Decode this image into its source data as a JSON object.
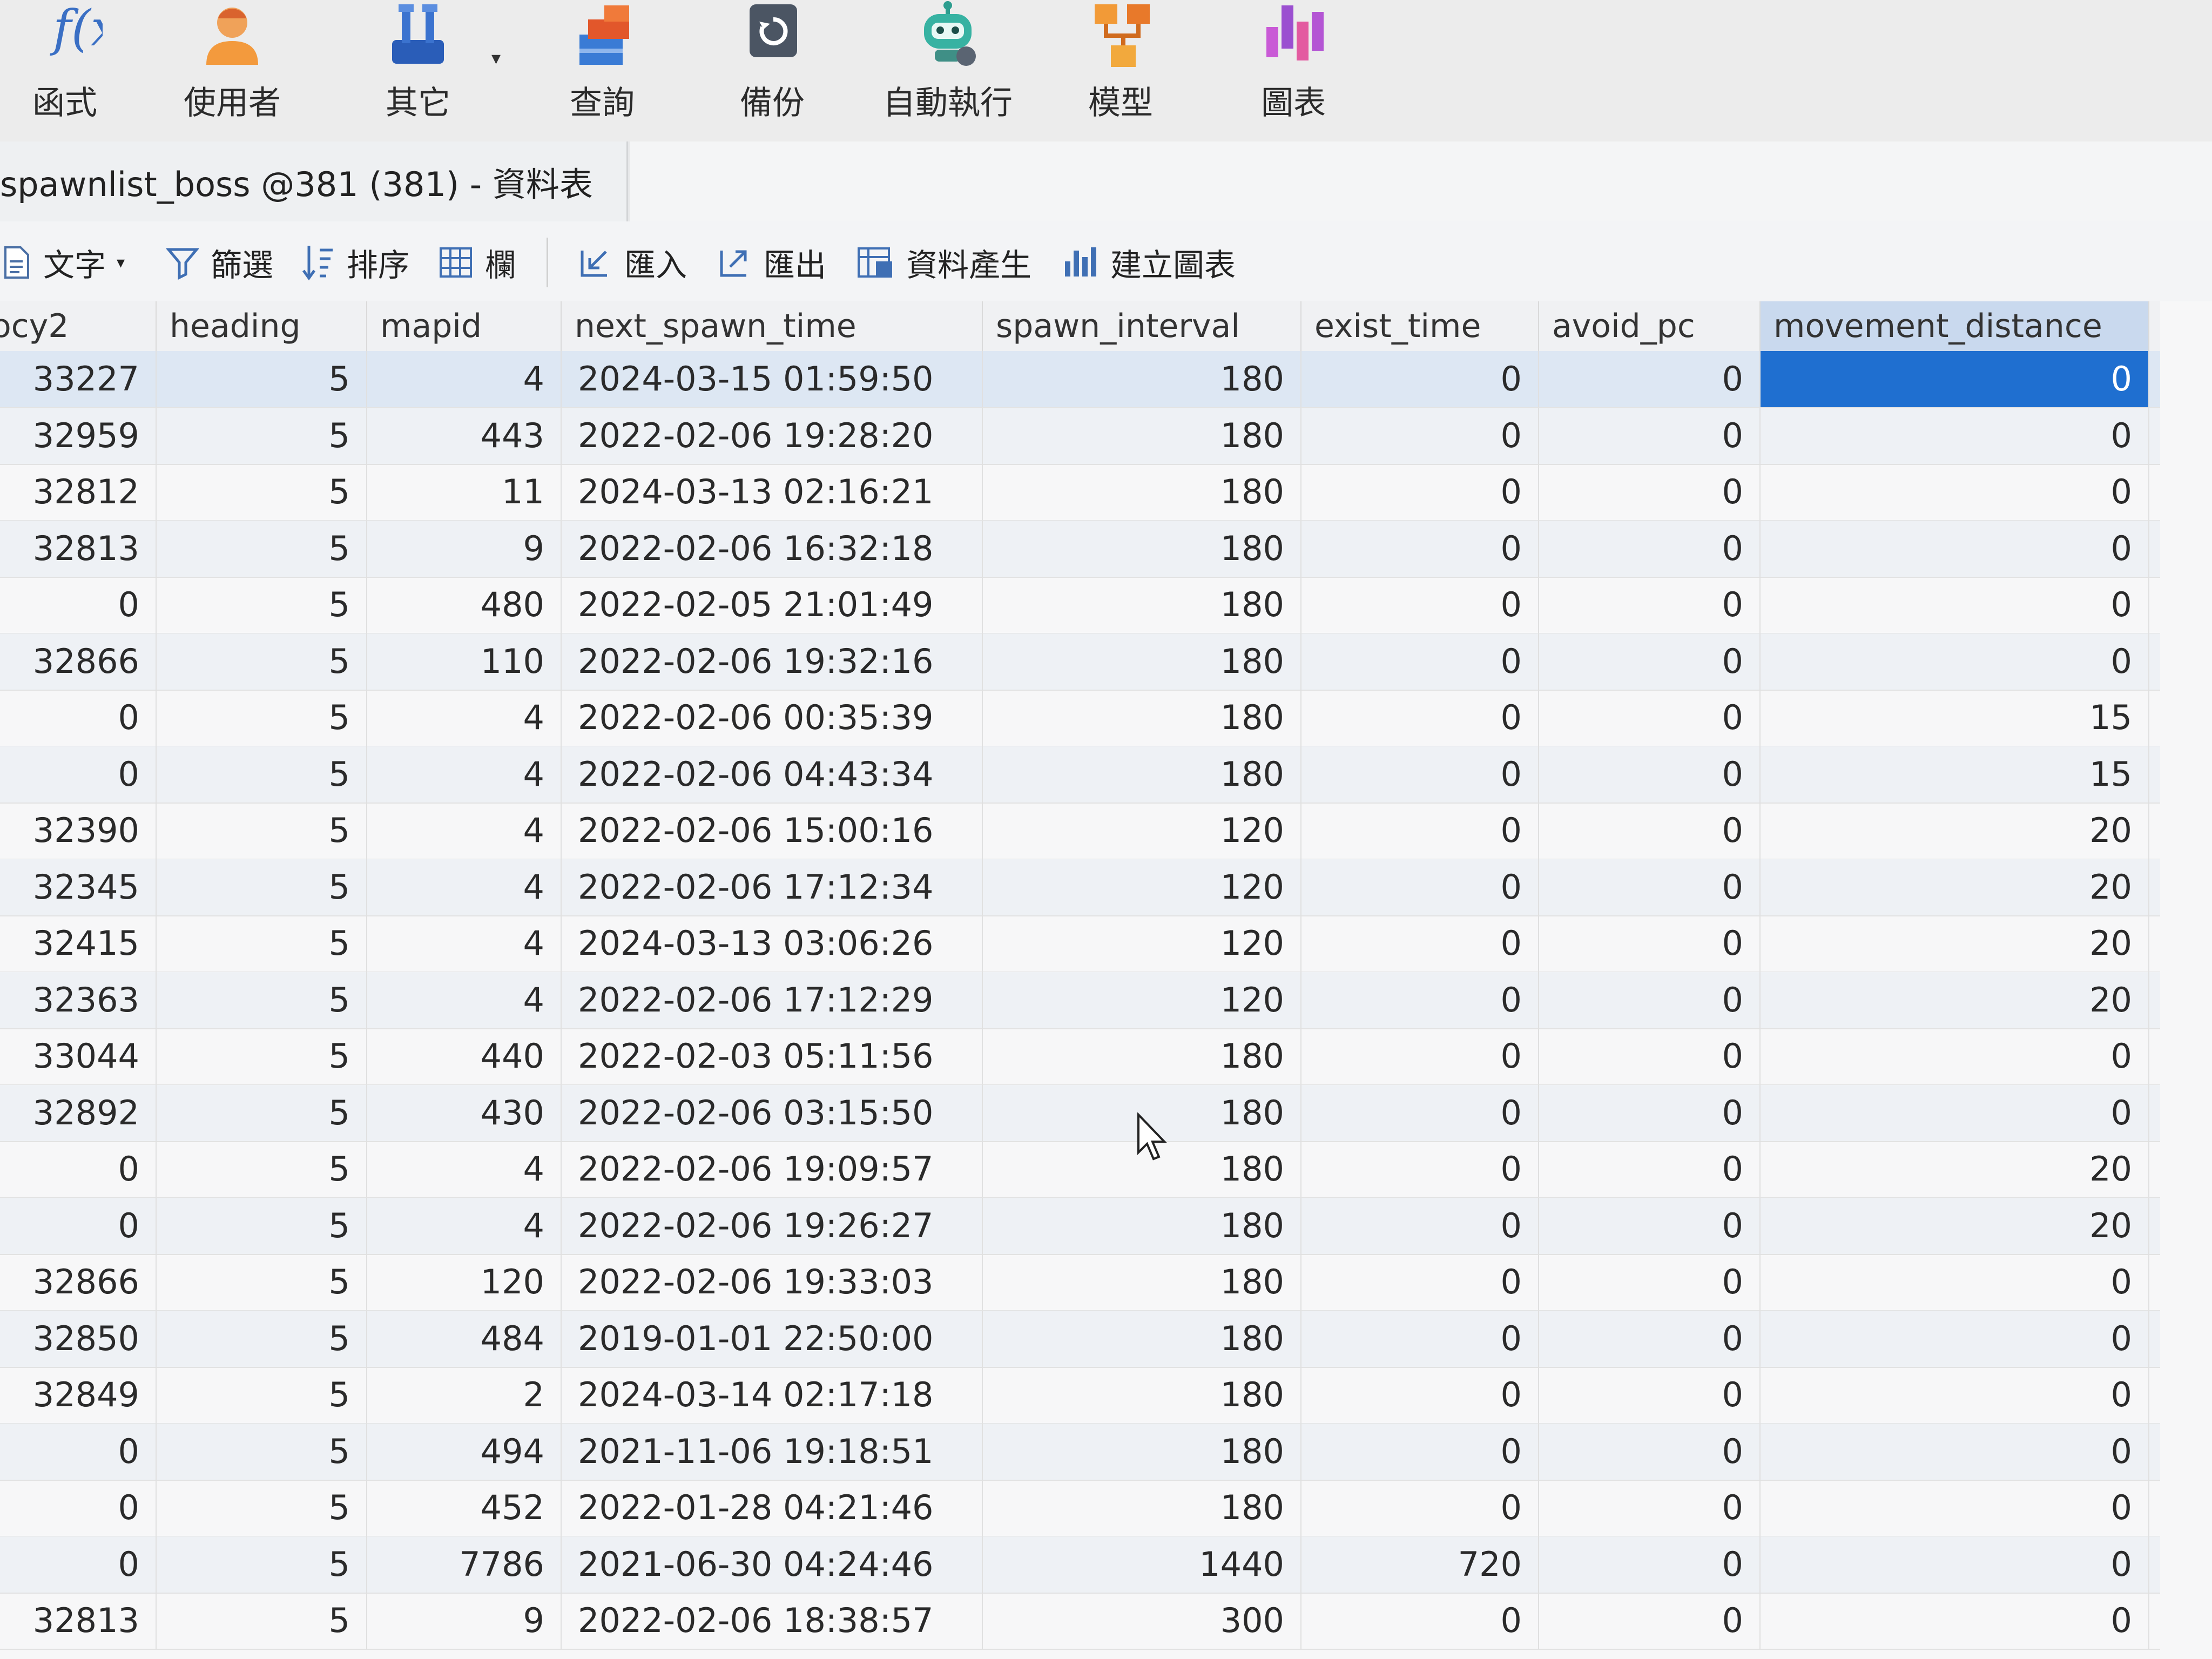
{
  "ribbon": {
    "items": [
      {
        "label": "函式",
        "icon": "function-icon"
      },
      {
        "label": "使用者",
        "icon": "user-icon"
      },
      {
        "label": "其它",
        "icon": "tools-icon"
      },
      {
        "label": "查詢",
        "icon": "query-icon"
      },
      {
        "label": "備份",
        "icon": "backup-icon"
      },
      {
        "label": "自動執行",
        "icon": "robot-icon"
      },
      {
        "label": "模型",
        "icon": "model-icon"
      },
      {
        "label": "圖表",
        "icon": "chart-icon"
      }
    ],
    "fx_text": "f(x)"
  },
  "tab": {
    "title": "spawnlist_boss @381 (381) - 資料表"
  },
  "toolbar": {
    "text_label": "文字",
    "filter_label": "篩選",
    "sort_label": "排序",
    "columns_label": "欄",
    "import_label": "匯入",
    "export_label": "匯出",
    "generate_label": "資料產生",
    "create_chart_label": "建立圖表"
  },
  "table": {
    "columns": [
      "ocy2",
      "heading",
      "mapid",
      "next_spawn_time",
      "spawn_interval",
      "exist_time",
      "avoid_pc",
      "movement_distance"
    ],
    "rows": [
      [
        "33227",
        "5",
        "4",
        "2024-03-15 01:59:50",
        "180",
        "0",
        "0",
        "0"
      ],
      [
        "32959",
        "5",
        "443",
        "2022-02-06 19:28:20",
        "180",
        "0",
        "0",
        "0"
      ],
      [
        "32812",
        "5",
        "11",
        "2024-03-13 02:16:21",
        "180",
        "0",
        "0",
        "0"
      ],
      [
        "32813",
        "5",
        "9",
        "2022-02-06 16:32:18",
        "180",
        "0",
        "0",
        "0"
      ],
      [
        "0",
        "5",
        "480",
        "2022-02-05 21:01:49",
        "180",
        "0",
        "0",
        "0"
      ],
      [
        "32866",
        "5",
        "110",
        "2022-02-06 19:32:16",
        "180",
        "0",
        "0",
        "0"
      ],
      [
        "0",
        "5",
        "4",
        "2022-02-06 00:35:39",
        "180",
        "0",
        "0",
        "15"
      ],
      [
        "0",
        "5",
        "4",
        "2022-02-06 04:43:34",
        "180",
        "0",
        "0",
        "15"
      ],
      [
        "32390",
        "5",
        "4",
        "2022-02-06 15:00:16",
        "120",
        "0",
        "0",
        "20"
      ],
      [
        "32345",
        "5",
        "4",
        "2022-02-06 17:12:34",
        "120",
        "0",
        "0",
        "20"
      ],
      [
        "32415",
        "5",
        "4",
        "2024-03-13 03:06:26",
        "120",
        "0",
        "0",
        "20"
      ],
      [
        "32363",
        "5",
        "4",
        "2022-02-06 17:12:29",
        "120",
        "0",
        "0",
        "20"
      ],
      [
        "33044",
        "5",
        "440",
        "2022-02-03 05:11:56",
        "180",
        "0",
        "0",
        "0"
      ],
      [
        "32892",
        "5",
        "430",
        "2022-02-06 03:15:50",
        "180",
        "0",
        "0",
        "0"
      ],
      [
        "0",
        "5",
        "4",
        "2022-02-06 19:09:57",
        "180",
        "0",
        "0",
        "20"
      ],
      [
        "0",
        "5",
        "4",
        "2022-02-06 19:26:27",
        "180",
        "0",
        "0",
        "20"
      ],
      [
        "32866",
        "5",
        "120",
        "2022-02-06 19:33:03",
        "180",
        "0",
        "0",
        "0"
      ],
      [
        "32850",
        "5",
        "484",
        "2019-01-01 22:50:00",
        "180",
        "0",
        "0",
        "0"
      ],
      [
        "32849",
        "5",
        "2",
        "2024-03-14 02:17:18",
        "180",
        "0",
        "0",
        "0"
      ],
      [
        "0",
        "5",
        "494",
        "2021-11-06 19:18:51",
        "180",
        "0",
        "0",
        "0"
      ],
      [
        "0",
        "5",
        "452",
        "2022-01-28 04:21:46",
        "180",
        "0",
        "0",
        "0"
      ],
      [
        "0",
        "5",
        "7786",
        "2021-06-30 04:24:46",
        "1440",
        "720",
        "0",
        "0"
      ],
      [
        "32813",
        "5",
        "9",
        "2022-02-06 18:38:57",
        "300",
        "0",
        "0",
        "0"
      ]
    ]
  },
  "colors": {
    "selection": "#1f6fd0",
    "current_row": "#dde7f3"
  }
}
